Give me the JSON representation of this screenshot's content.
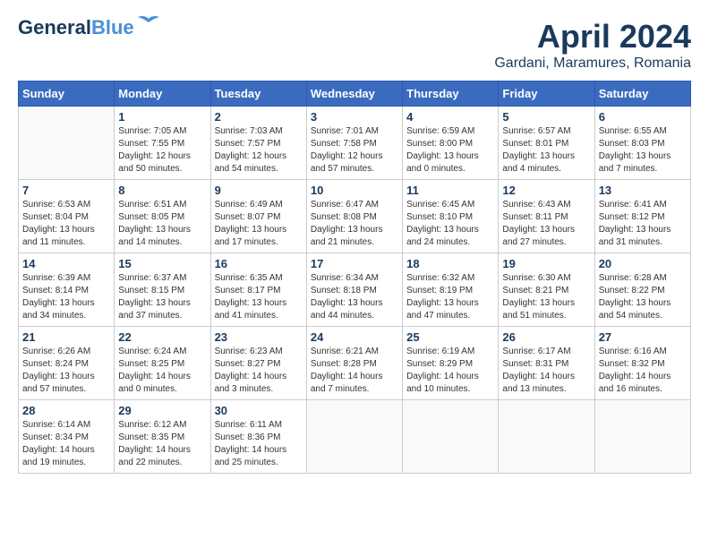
{
  "logo": {
    "line1": "General",
    "line2": "Blue"
  },
  "title": "April 2024",
  "location": "Gardani, Maramures, Romania",
  "days_of_week": [
    "Sunday",
    "Monday",
    "Tuesday",
    "Wednesday",
    "Thursday",
    "Friday",
    "Saturday"
  ],
  "weeks": [
    [
      {
        "day": "",
        "info": ""
      },
      {
        "day": "1",
        "info": "Sunrise: 7:05 AM\nSunset: 7:55 PM\nDaylight: 12 hours\nand 50 minutes."
      },
      {
        "day": "2",
        "info": "Sunrise: 7:03 AM\nSunset: 7:57 PM\nDaylight: 12 hours\nand 54 minutes."
      },
      {
        "day": "3",
        "info": "Sunrise: 7:01 AM\nSunset: 7:58 PM\nDaylight: 12 hours\nand 57 minutes."
      },
      {
        "day": "4",
        "info": "Sunrise: 6:59 AM\nSunset: 8:00 PM\nDaylight: 13 hours\nand 0 minutes."
      },
      {
        "day": "5",
        "info": "Sunrise: 6:57 AM\nSunset: 8:01 PM\nDaylight: 13 hours\nand 4 minutes."
      },
      {
        "day": "6",
        "info": "Sunrise: 6:55 AM\nSunset: 8:03 PM\nDaylight: 13 hours\nand 7 minutes."
      }
    ],
    [
      {
        "day": "7",
        "info": "Sunrise: 6:53 AM\nSunset: 8:04 PM\nDaylight: 13 hours\nand 11 minutes."
      },
      {
        "day": "8",
        "info": "Sunrise: 6:51 AM\nSunset: 8:05 PM\nDaylight: 13 hours\nand 14 minutes."
      },
      {
        "day": "9",
        "info": "Sunrise: 6:49 AM\nSunset: 8:07 PM\nDaylight: 13 hours\nand 17 minutes."
      },
      {
        "day": "10",
        "info": "Sunrise: 6:47 AM\nSunset: 8:08 PM\nDaylight: 13 hours\nand 21 minutes."
      },
      {
        "day": "11",
        "info": "Sunrise: 6:45 AM\nSunset: 8:10 PM\nDaylight: 13 hours\nand 24 minutes."
      },
      {
        "day": "12",
        "info": "Sunrise: 6:43 AM\nSunset: 8:11 PM\nDaylight: 13 hours\nand 27 minutes."
      },
      {
        "day": "13",
        "info": "Sunrise: 6:41 AM\nSunset: 8:12 PM\nDaylight: 13 hours\nand 31 minutes."
      }
    ],
    [
      {
        "day": "14",
        "info": "Sunrise: 6:39 AM\nSunset: 8:14 PM\nDaylight: 13 hours\nand 34 minutes."
      },
      {
        "day": "15",
        "info": "Sunrise: 6:37 AM\nSunset: 8:15 PM\nDaylight: 13 hours\nand 37 minutes."
      },
      {
        "day": "16",
        "info": "Sunrise: 6:35 AM\nSunset: 8:17 PM\nDaylight: 13 hours\nand 41 minutes."
      },
      {
        "day": "17",
        "info": "Sunrise: 6:34 AM\nSunset: 8:18 PM\nDaylight: 13 hours\nand 44 minutes."
      },
      {
        "day": "18",
        "info": "Sunrise: 6:32 AM\nSunset: 8:19 PM\nDaylight: 13 hours\nand 47 minutes."
      },
      {
        "day": "19",
        "info": "Sunrise: 6:30 AM\nSunset: 8:21 PM\nDaylight: 13 hours\nand 51 minutes."
      },
      {
        "day": "20",
        "info": "Sunrise: 6:28 AM\nSunset: 8:22 PM\nDaylight: 13 hours\nand 54 minutes."
      }
    ],
    [
      {
        "day": "21",
        "info": "Sunrise: 6:26 AM\nSunset: 8:24 PM\nDaylight: 13 hours\nand 57 minutes."
      },
      {
        "day": "22",
        "info": "Sunrise: 6:24 AM\nSunset: 8:25 PM\nDaylight: 14 hours\nand 0 minutes."
      },
      {
        "day": "23",
        "info": "Sunrise: 6:23 AM\nSunset: 8:27 PM\nDaylight: 14 hours\nand 3 minutes."
      },
      {
        "day": "24",
        "info": "Sunrise: 6:21 AM\nSunset: 8:28 PM\nDaylight: 14 hours\nand 7 minutes."
      },
      {
        "day": "25",
        "info": "Sunrise: 6:19 AM\nSunset: 8:29 PM\nDaylight: 14 hours\nand 10 minutes."
      },
      {
        "day": "26",
        "info": "Sunrise: 6:17 AM\nSunset: 8:31 PM\nDaylight: 14 hours\nand 13 minutes."
      },
      {
        "day": "27",
        "info": "Sunrise: 6:16 AM\nSunset: 8:32 PM\nDaylight: 14 hours\nand 16 minutes."
      }
    ],
    [
      {
        "day": "28",
        "info": "Sunrise: 6:14 AM\nSunset: 8:34 PM\nDaylight: 14 hours\nand 19 minutes."
      },
      {
        "day": "29",
        "info": "Sunrise: 6:12 AM\nSunset: 8:35 PM\nDaylight: 14 hours\nand 22 minutes."
      },
      {
        "day": "30",
        "info": "Sunrise: 6:11 AM\nSunset: 8:36 PM\nDaylight: 14 hours\nand 25 minutes."
      },
      {
        "day": "",
        "info": ""
      },
      {
        "day": "",
        "info": ""
      },
      {
        "day": "",
        "info": ""
      },
      {
        "day": "",
        "info": ""
      }
    ]
  ]
}
